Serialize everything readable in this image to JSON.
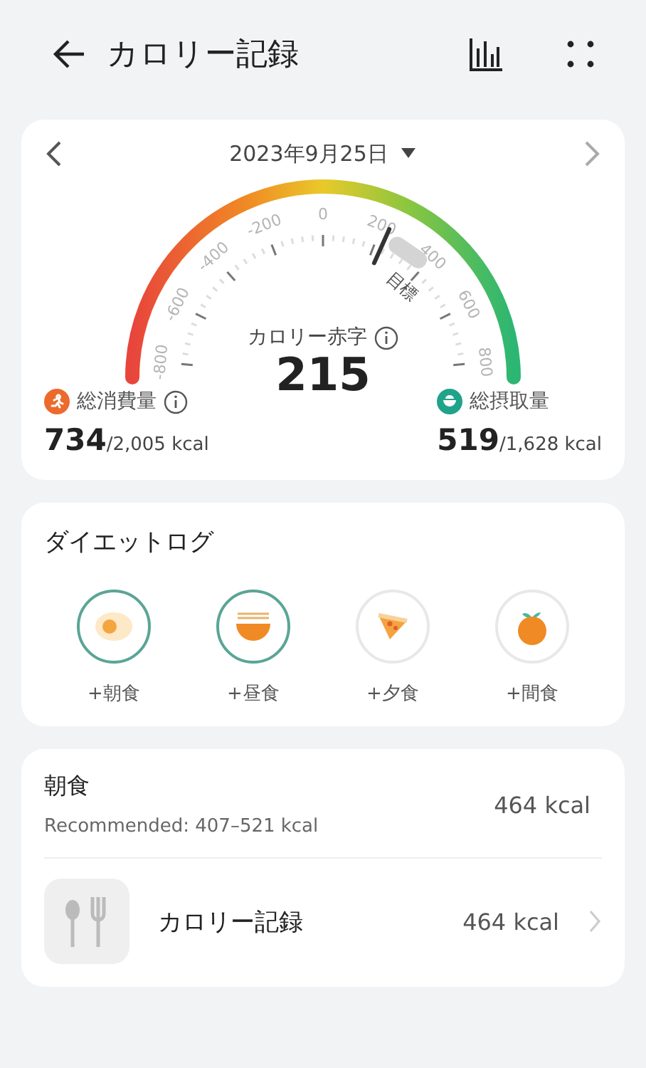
{
  "header": {
    "title": "カロリー記録"
  },
  "summary": {
    "date": "2023年9月25日",
    "gauge": {
      "target_label": "目標",
      "ticks": [
        "-800",
        "-600",
        "-400",
        "-200",
        "0",
        "200",
        "400",
        "600",
        "800"
      ]
    },
    "deficit_label": "カロリー赤字",
    "deficit_value": "215",
    "burned": {
      "label": "総消費量",
      "value": "734",
      "total": "/2,005 kcal"
    },
    "intake": {
      "label": "総摂取量",
      "value": "519",
      "total": "/1,628 kcal"
    }
  },
  "diet_log": {
    "title": "ダイエットログ",
    "meals": [
      {
        "kind": "egg",
        "label": "+朝食",
        "logged": true
      },
      {
        "kind": "noodles",
        "label": "+昼食",
        "logged": true
      },
      {
        "kind": "pizza",
        "label": "+夕食",
        "logged": false
      },
      {
        "kind": "orange",
        "label": "+間食",
        "logged": false
      }
    ]
  },
  "breakfast": {
    "title": "朝食",
    "recommended": "Recommended: 407–521 kcal",
    "total": "464 kcal",
    "entries": [
      {
        "name": "カロリー記録",
        "kcal": "464 kcal"
      }
    ]
  }
}
